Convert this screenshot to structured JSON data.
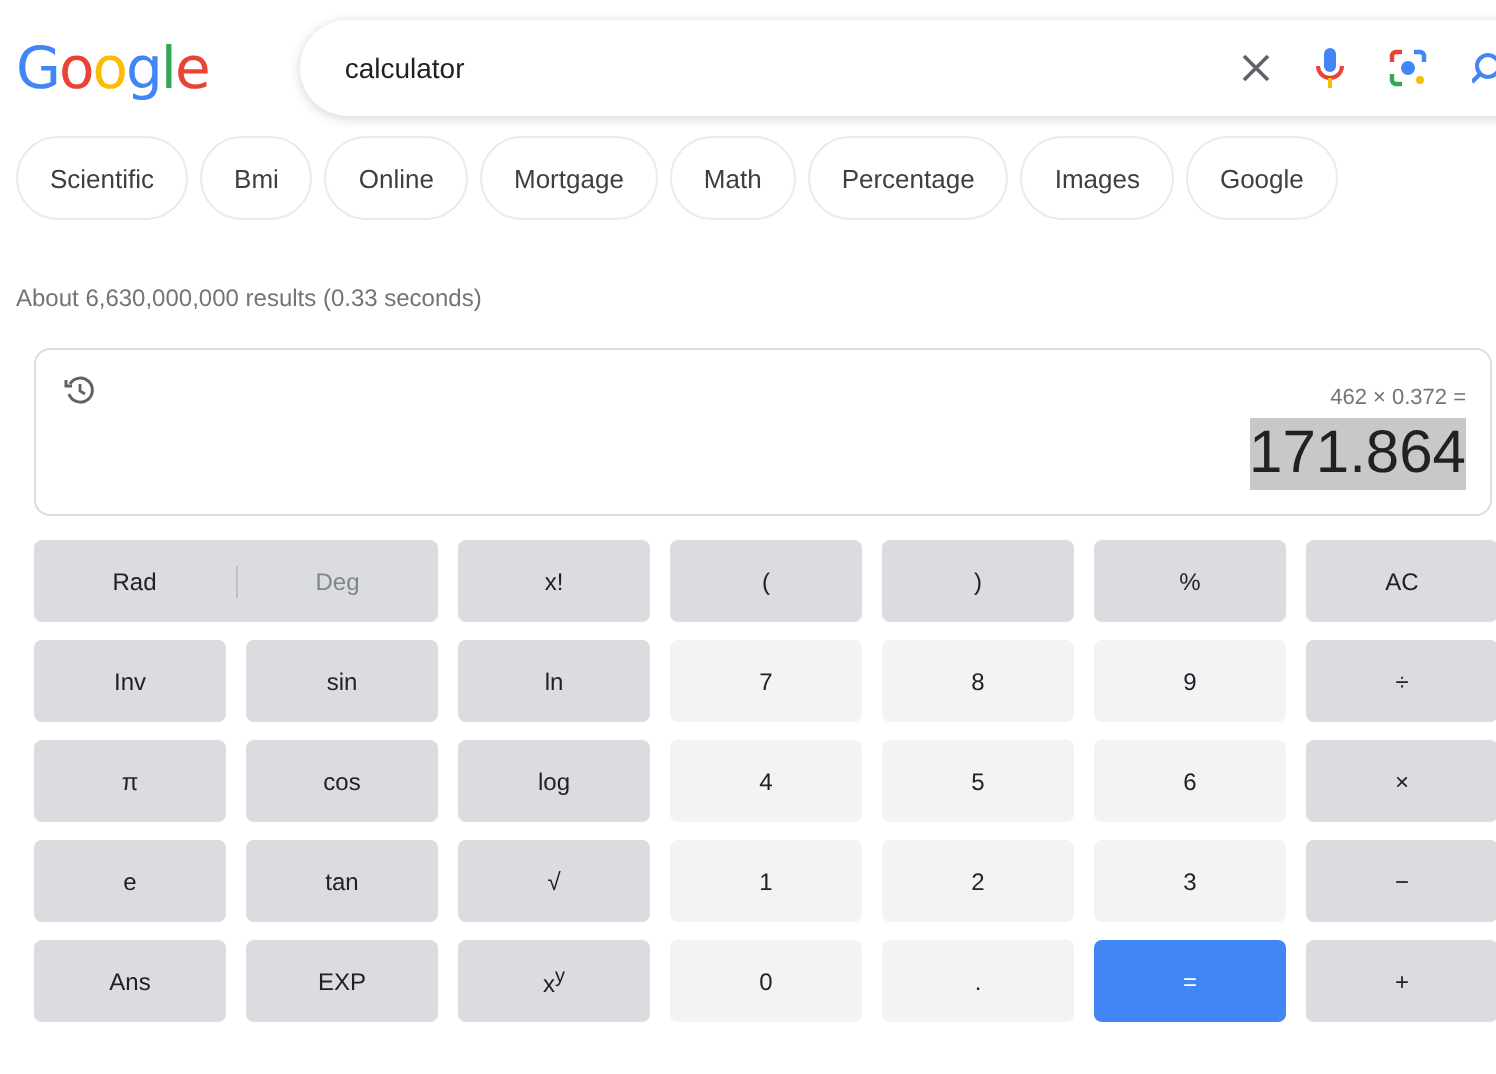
{
  "logo": "Google",
  "search": {
    "value": "calculator"
  },
  "chips": [
    "Scientific",
    "Bmi",
    "Online",
    "Mortgage",
    "Math",
    "Percentage",
    "Images",
    "Google"
  ],
  "result_stats": "About 6,630,000,000 results (0.33 seconds)",
  "calculator": {
    "expression": "462 × 0.372 =",
    "result": "171.864",
    "keys": [
      {
        "kind": "toggle",
        "options": [
          {
            "label": "Rad",
            "selected": true
          },
          {
            "label": "Deg",
            "selected": false
          }
        ]
      },
      {
        "kind": "fn",
        "label": "x!"
      },
      {
        "kind": "fn",
        "label": "("
      },
      {
        "kind": "fn",
        "label": ")"
      },
      {
        "kind": "fn",
        "label": "%"
      },
      {
        "kind": "fn",
        "label": "AC"
      },
      {
        "kind": "fn",
        "label": "Inv"
      },
      {
        "kind": "fn",
        "label": "sin"
      },
      {
        "kind": "fn",
        "label": "ln"
      },
      {
        "kind": "num",
        "label": "7"
      },
      {
        "kind": "num",
        "label": "8"
      },
      {
        "kind": "num",
        "label": "9"
      },
      {
        "kind": "fn",
        "label": "÷"
      },
      {
        "kind": "fn",
        "label": "π"
      },
      {
        "kind": "fn",
        "label": "cos"
      },
      {
        "kind": "fn",
        "label": "log"
      },
      {
        "kind": "num",
        "label": "4"
      },
      {
        "kind": "num",
        "label": "5"
      },
      {
        "kind": "num",
        "label": "6"
      },
      {
        "kind": "fn",
        "label": "×"
      },
      {
        "kind": "fn",
        "label": "e"
      },
      {
        "kind": "fn",
        "label": "tan"
      },
      {
        "kind": "fn",
        "label": "√"
      },
      {
        "kind": "num",
        "label": "1"
      },
      {
        "kind": "num",
        "label": "2"
      },
      {
        "kind": "num",
        "label": "3"
      },
      {
        "kind": "fn",
        "label": "−"
      },
      {
        "kind": "fn",
        "label": "Ans"
      },
      {
        "kind": "fn",
        "label": "EXP"
      },
      {
        "kind": "fn",
        "label": "x$^{y}$"
      },
      {
        "kind": "num",
        "label": "0"
      },
      {
        "kind": "num",
        "label": "."
      },
      {
        "kind": "equals",
        "label": "="
      },
      {
        "kind": "fn",
        "label": "+"
      }
    ]
  }
}
